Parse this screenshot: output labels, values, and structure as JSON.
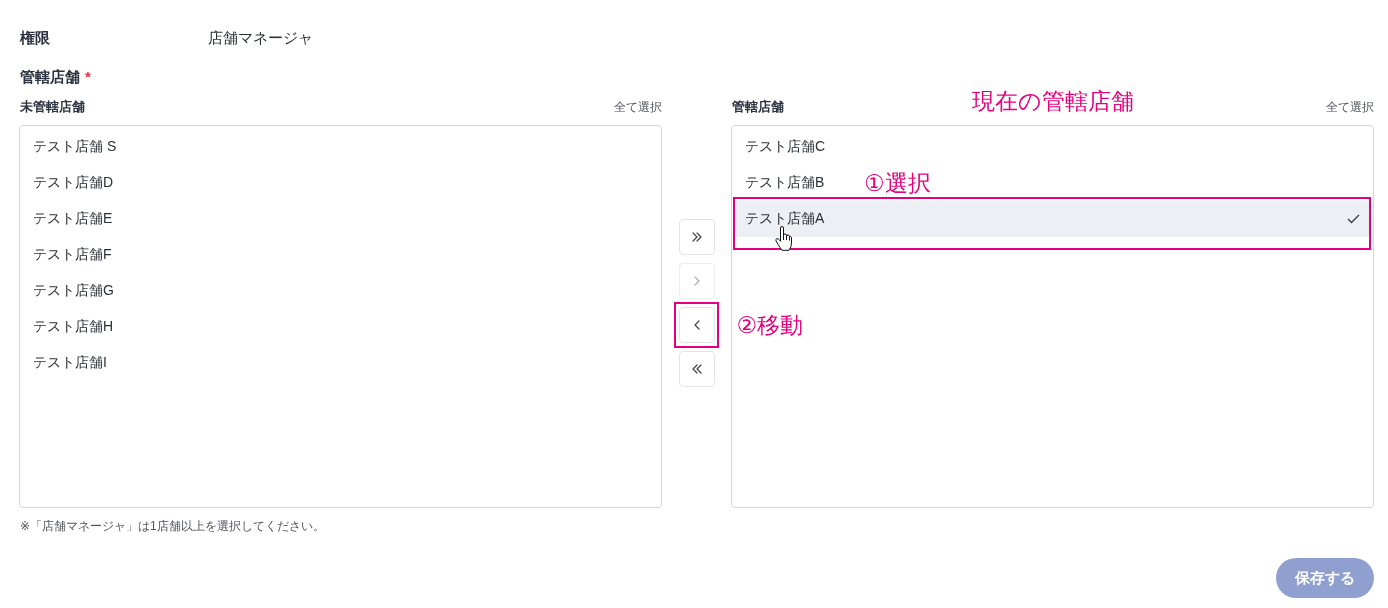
{
  "role": {
    "label": "権限",
    "value": "店舗マネージャ"
  },
  "stores_field": {
    "label": "管轄店舗",
    "required_mark": "*",
    "available": {
      "title": "未管轄店舗",
      "select_all": "全て選択",
      "items": [
        {
          "name": "テスト店舗 S",
          "selected": false,
          "hovered": false,
          "highlighted": false
        },
        {
          "name": "テスト店舗D",
          "selected": false,
          "hovered": false,
          "highlighted": false
        },
        {
          "name": "テスト店舗E",
          "selected": false,
          "hovered": false,
          "highlighted": false
        },
        {
          "name": "テスト店舗F",
          "selected": false,
          "hovered": false,
          "highlighted": false
        },
        {
          "name": "テスト店舗G",
          "selected": false,
          "hovered": false,
          "highlighted": false
        },
        {
          "name": "テスト店舗H",
          "selected": false,
          "hovered": false,
          "highlighted": false
        },
        {
          "name": "テスト店舗I",
          "selected": false,
          "hovered": false,
          "highlighted": false
        }
      ]
    },
    "transfer_buttons": [
      {
        "kind": "add_all",
        "disabled": false,
        "highlighted": false
      },
      {
        "kind": "add",
        "disabled": true,
        "highlighted": false
      },
      {
        "kind": "remove",
        "disabled": false,
        "highlighted": true,
        "annotation": "②移動"
      },
      {
        "kind": "remove_all",
        "disabled": false,
        "highlighted": false
      }
    ],
    "assigned": {
      "title": "管轄店舗",
      "select_all": "全て選択",
      "annotation": "現在の管轄店舗",
      "items": [
        {
          "name": "テスト店舗C",
          "selected": false,
          "hovered": false,
          "highlighted": false
        },
        {
          "name": "テスト店舗B",
          "selected": false,
          "hovered": false,
          "highlighted": false
        },
        {
          "name": "テスト店舗A",
          "selected": true,
          "hovered": true,
          "highlighted": true,
          "annotation": "①選択"
        }
      ]
    },
    "note": "※「店舗マネージャ」は1店舗以上を選択してください。"
  },
  "save_button": {
    "label": "保存する",
    "disabled": true
  }
}
